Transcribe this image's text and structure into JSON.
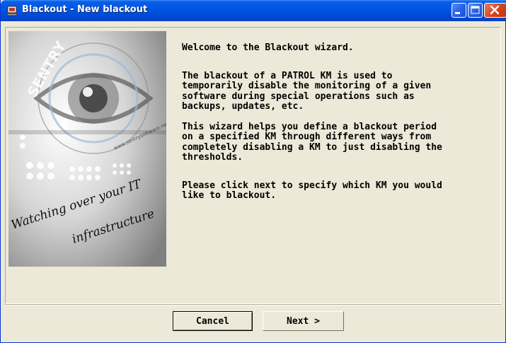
{
  "window": {
    "title": "Blackout - New blackout",
    "app_icon": "app-icon"
  },
  "title_buttons": [
    "minimize-icon",
    "maximize-icon",
    "close-icon"
  ],
  "side_image": {
    "brand_text": "SENTRY",
    "url_text": "www.sentrysoftware.net",
    "tagline_line1": "Watching over your IT",
    "tagline_line2": "infrastructure"
  },
  "paragraphs": [
    "Welcome to the Blackout wizard.",
    "The blackout of a PATROL KM is used to\ntemporarily disable the monitoring of a given\nsoftware during special operations such as\nbackups, updates, etc.",
    "This wizard helps you define a blackout period\non a specified KM through different ways from\ncompletely disabling a KM to just disabling the\nthresholds.",
    "Please click next to specify which KM you would\nlike to blackout."
  ],
  "buttons": {
    "cancel": "Cancel",
    "next": "Next >"
  },
  "colors": {
    "title_bar": "#0054e3",
    "dialog_bg": "#ece9d8",
    "close_button": "#d8431c"
  }
}
